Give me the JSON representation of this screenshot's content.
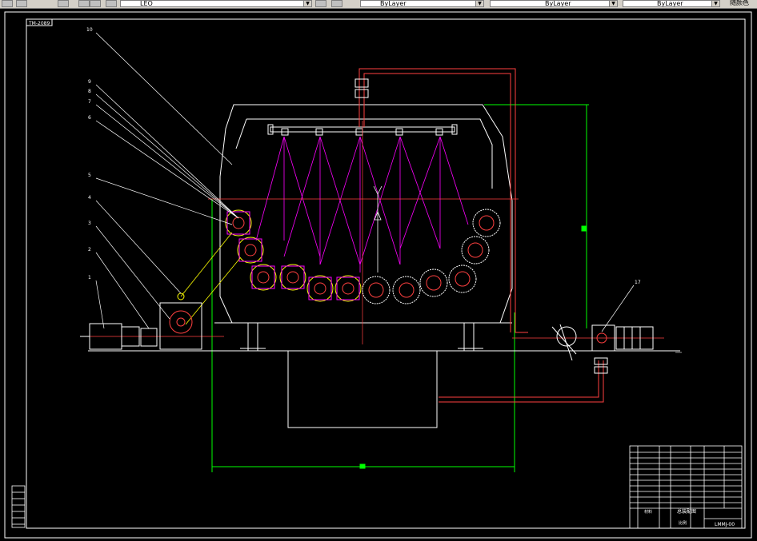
{
  "toolbar": {
    "layer_name": "LEO",
    "color_control": "ByLayer",
    "linetype_control": "ByLayer",
    "lineweight_control": "ByLayer",
    "plotstyle_control": "随颜色"
  },
  "drawing": {
    "frame_tag": "TM-2089",
    "part_callouts": [
      "10",
      "9",
      "8",
      "7",
      "6",
      "5",
      "4",
      "3",
      "2",
      "1",
      "17"
    ],
    "title_block": {
      "drawing_title": "总装配图",
      "drawing_number": "LMMJ-00",
      "material_label": "材料",
      "scale_label": "比例"
    }
  },
  "colors": {
    "outline": "#ffffff",
    "pipe": "#ff4040",
    "spray": "#ff00ff",
    "dimension": "#00ff00",
    "leader": "#ffffff",
    "highlight": "#ffff00"
  }
}
